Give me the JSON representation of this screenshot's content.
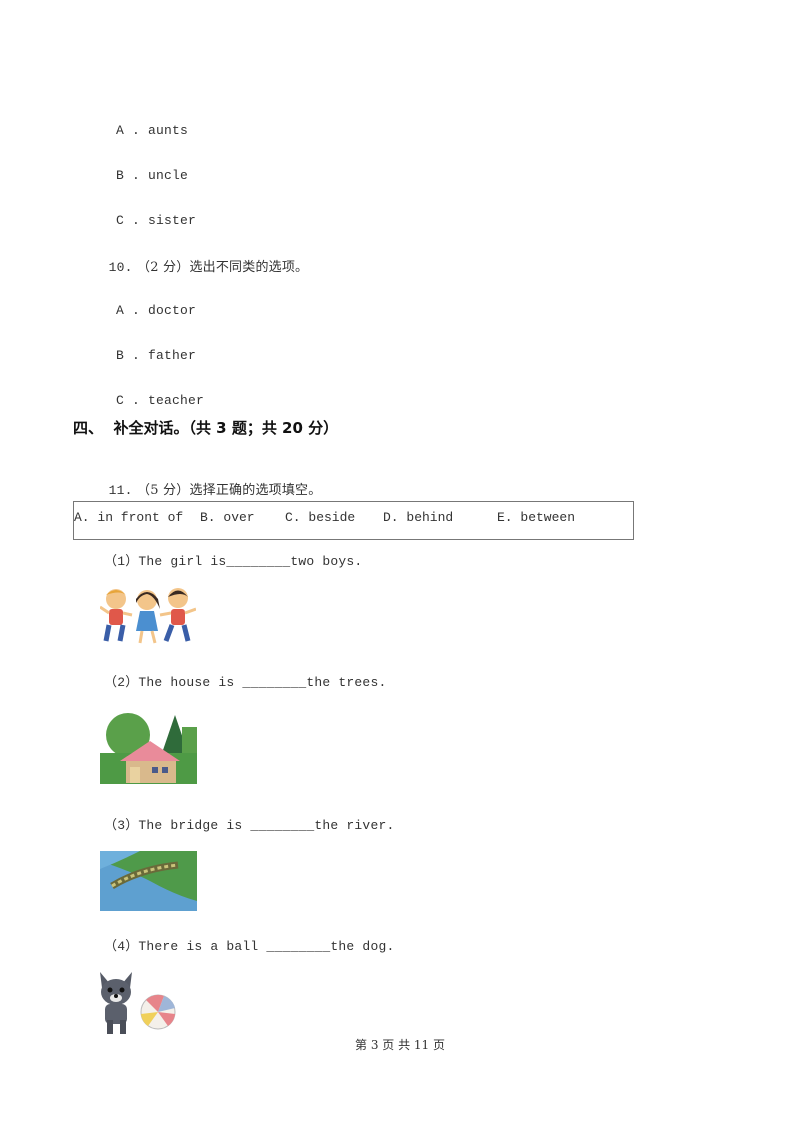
{
  "q9_options": [
    {
      "label": "A",
      "text": "aunts"
    },
    {
      "label": "B",
      "text": "uncle"
    },
    {
      "label": "C",
      "text": "sister"
    }
  ],
  "q10": {
    "number": "10.",
    "score": "（2 分）",
    "prompt": "选出不同类的选项。",
    "options": [
      {
        "label": "A",
        "text": "doctor"
      },
      {
        "label": "B",
        "text": "father"
      },
      {
        "label": "C",
        "text": "teacher"
      }
    ]
  },
  "section": {
    "title": "四、  补全对话。（共 3 题；共 20 分）"
  },
  "q11": {
    "number": "11.",
    "score": "（5 分）",
    "prompt": "选择正确的选项填空。",
    "choices": [
      "A. in front of",
      "B. over",
      "C. beside",
      "D. behind",
      "E. between"
    ],
    "items": [
      {
        "text": "（1）The girl is________two boys.",
        "image": "three-children-picture"
      },
      {
        "text": "（2）The house is ________the trees.",
        "image": "house-trees-picture"
      },
      {
        "text": "（3）The bridge is ________the river.",
        "image": "bridge-river-picture"
      },
      {
        "text": "（4）There is a ball ________the dog.",
        "image": "dog-ball-picture"
      }
    ]
  },
  "footer": {
    "page_text": "第 3 页 共 11 页"
  }
}
